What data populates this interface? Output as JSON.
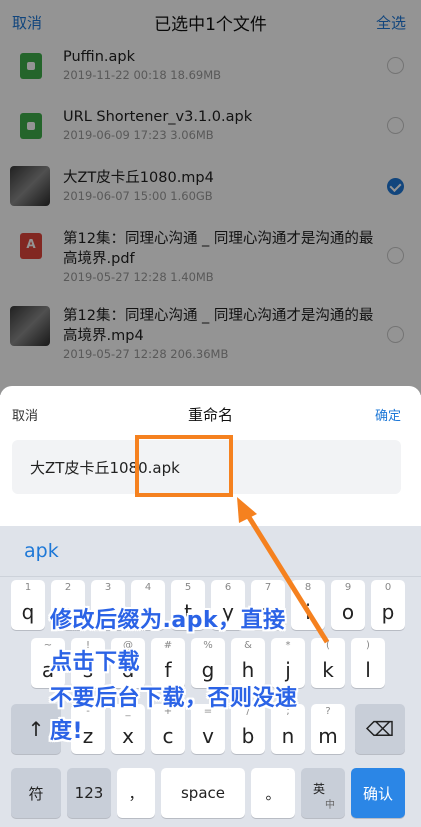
{
  "header": {
    "cancel": "取消",
    "title": "已选中1个文件",
    "select_all": "全选"
  },
  "files": [
    {
      "name": "Puffin.apk",
      "meta": "2019-11-22  00:18  18.69MB",
      "type": "apk",
      "selected": false
    },
    {
      "name": "URL Shortener_v3.1.0.apk",
      "meta": "2019-06-09  17:23  3.06MB",
      "type": "apk",
      "selected": false
    },
    {
      "name": "大ZT皮卡丘1080.mp4",
      "meta": "2019-06-07  15:00  1.60GB",
      "type": "video",
      "selected": true
    },
    {
      "name": "第12集：同理心沟通 _ 同理心沟通才是沟通的最高境界.pdf",
      "meta": "2019-05-27  12:28  1.40MB",
      "type": "pdf",
      "selected": false
    },
    {
      "name": "第12集：同理心沟通 _ 同理心沟通才是沟通的最高境界.mp4",
      "meta": "2019-05-27  12:28  206.36MB",
      "type": "video",
      "selected": false
    }
  ],
  "dialog": {
    "cancel": "取消",
    "title": "重命名",
    "confirm": "确定",
    "input_value": "大ZT皮卡丘1080.apk"
  },
  "keyboard": {
    "suggestion": "apk",
    "row1": [
      {
        "k": "q",
        "s": "1"
      },
      {
        "k": "w",
        "s": "2"
      },
      {
        "k": "e",
        "s": "3"
      },
      {
        "k": "r",
        "s": "4"
      },
      {
        "k": "t",
        "s": "5"
      },
      {
        "k": "y",
        "s": "6"
      },
      {
        "k": "u",
        "s": "7"
      },
      {
        "k": "i",
        "s": "8"
      },
      {
        "k": "o",
        "s": "9"
      },
      {
        "k": "p",
        "s": "0"
      }
    ],
    "row2": [
      {
        "k": "a",
        "s": "~"
      },
      {
        "k": "s",
        "s": "!"
      },
      {
        "k": "d",
        "s": "@"
      },
      {
        "k": "f",
        "s": "#"
      },
      {
        "k": "g",
        "s": "%"
      },
      {
        "k": "h",
        "s": "&"
      },
      {
        "k": "j",
        "s": "*"
      },
      {
        "k": "k",
        "s": "("
      },
      {
        "k": "l",
        "s": ")"
      }
    ],
    "row3": [
      {
        "k": "z",
        "s": "-"
      },
      {
        "k": "x",
        "s": "_"
      },
      {
        "k": "c",
        "s": "+"
      },
      {
        "k": "v",
        "s": "="
      },
      {
        "k": "b",
        "s": "/"
      },
      {
        "k": "n",
        "s": ";"
      },
      {
        "k": "m",
        "s": "?"
      }
    ],
    "shift": "↑",
    "backspace": "⌫",
    "sym": "符",
    "num": "123",
    "comma": "，",
    "space": "space",
    "period": "。",
    "lang_top": "英",
    "lang_bottom": "中",
    "enter": "确认"
  },
  "annotation": {
    "line1": "修改后缀为.apk，直接",
    "line2": "点击下载",
    "line3": "不要后台下载，否则没速",
    "line4": "度!",
    "color": "#2b63e6",
    "box_color": "#f5811f"
  }
}
